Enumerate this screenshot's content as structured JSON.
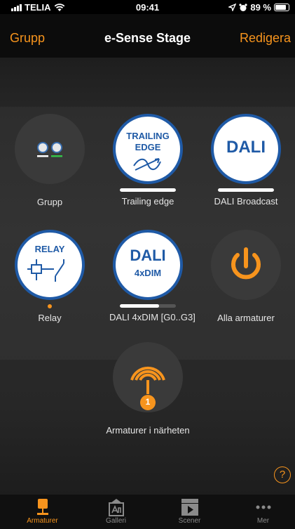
{
  "status_bar": {
    "carrier": "TELIA",
    "time": "09:41",
    "battery": "89 %"
  },
  "nav": {
    "left": "Grupp",
    "title": "e-Sense Stage",
    "right": "Redigera"
  },
  "tiles": [
    {
      "label": "Grupp"
    },
    {
      "label": "Trailing edge",
      "badge_line1": "TRAILING",
      "badge_line2": "EDGE",
      "level": 1.0
    },
    {
      "label": "DALI Broadcast",
      "badge_text": "DALI",
      "level": 1.0
    },
    {
      "label": "Relay",
      "badge_text": "RELAY"
    },
    {
      "label": "DALI 4xDIM [G0..G3]",
      "badge_line1": "DALI",
      "badge_line2": "4xDIM",
      "level": 0.7
    },
    {
      "label": "Alla armaturer"
    },
    {
      "label": "Armaturer i närheten",
      "count": "1"
    }
  ],
  "help": "?",
  "tabs": [
    {
      "label": "Armaturer",
      "icon": "lamp-icon",
      "active": true
    },
    {
      "label": "Galleri",
      "icon": "gallery-icon",
      "active": false
    },
    {
      "label": "Scener",
      "icon": "scenes-icon",
      "active": false
    },
    {
      "label": "Mer",
      "icon": "more-icon",
      "active": false
    }
  ],
  "colors": {
    "accent": "#f7941d",
    "badge_blue": "#1f5aa6",
    "background": "#2a2a2a"
  }
}
